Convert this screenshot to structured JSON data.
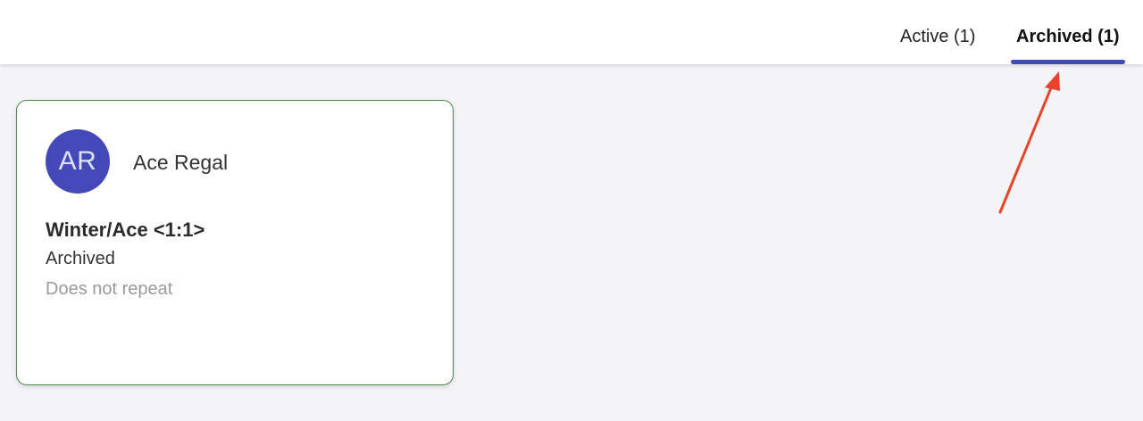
{
  "tabs": [
    {
      "label": "Active (1)"
    },
    {
      "label": "Archived (1)"
    }
  ],
  "card": {
    "avatar_initials": "AR",
    "person_name": "Ace Regal",
    "title": "Winter/Ace <1:1>",
    "status": "Archived",
    "repeat": "Does not repeat"
  },
  "colors": {
    "accent": "#3f4bb5",
    "avatar_bg": "#4349b8",
    "avatar_text": "#dfe2ff",
    "muted_text": "#9a9a9a",
    "annotation_arrow": "#e8432b"
  }
}
